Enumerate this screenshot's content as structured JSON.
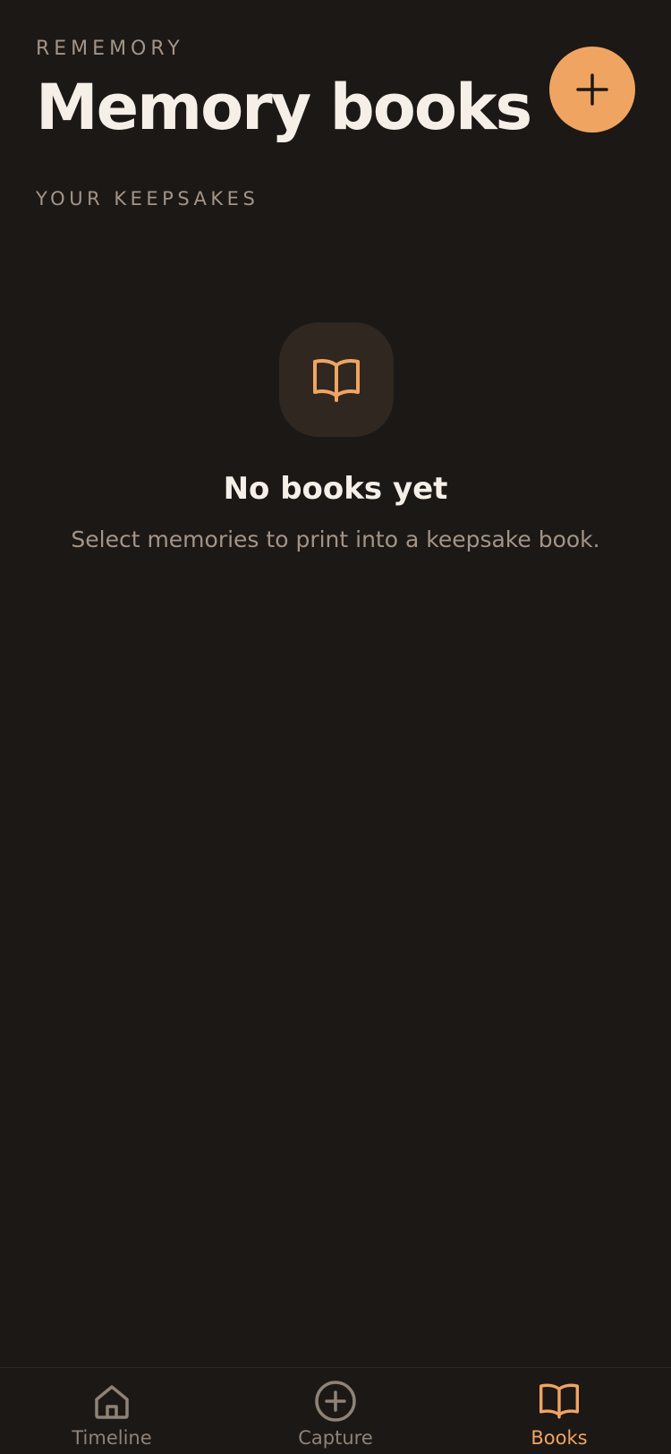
{
  "header": {
    "app_name": "REMEMORY",
    "title": "Memory books",
    "add_icon": "plus-icon"
  },
  "section": {
    "label": "YOUR KEEPSAKES"
  },
  "empty_state": {
    "icon": "book-open-icon",
    "title": "No books yet",
    "subtitle": "Select memories to print into a keepsake book."
  },
  "tabbar": {
    "tabs": [
      {
        "label": "Timeline",
        "icon": "home-icon",
        "active": false
      },
      {
        "label": "Capture",
        "icon": "plus-circle-icon",
        "active": false
      },
      {
        "label": "Books",
        "icon": "book-open-icon",
        "active": true
      }
    ]
  },
  "colors": {
    "background": "#1c1816",
    "accent": "#f0a461",
    "text_primary": "#f6efe7",
    "text_muted": "#a39486",
    "icon_box": "#2f2720"
  }
}
